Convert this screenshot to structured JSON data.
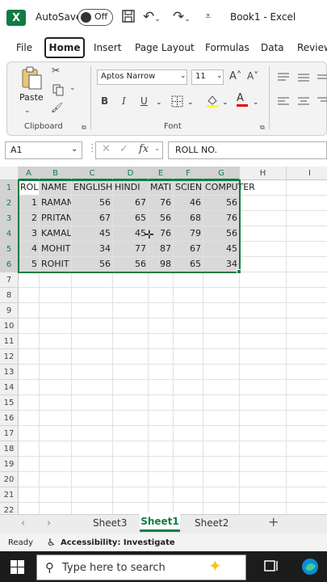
{
  "titlebar": {
    "autosave_label": "AutoSave",
    "toggle_state": "Off",
    "book_title": "Book1 - Excel"
  },
  "tabs": [
    "File",
    "Home",
    "Insert",
    "Page Layout",
    "Formulas",
    "Data",
    "Review"
  ],
  "ribbon": {
    "paste_label": "Paste",
    "clipboard_label": "Clipboard",
    "font_label": "Font",
    "font_name": "Aptos Narrow",
    "font_size": "11",
    "bold": "B",
    "italic": "I",
    "underline": "U",
    "grow_font": "A˄",
    "shrink_font": "A˅",
    "font_color_letter": "A"
  },
  "formula_bar": {
    "name_box": "A1",
    "fx": "fx",
    "value": "ROLL NO."
  },
  "columns": [
    "A",
    "B",
    "C",
    "D",
    "E",
    "F",
    "G",
    "H",
    "I"
  ],
  "rows": [
    "1",
    "2",
    "3",
    "4",
    "5",
    "6",
    "7",
    "8",
    "9",
    "10",
    "11",
    "12",
    "13",
    "14",
    "15",
    "16",
    "17",
    "18",
    "19",
    "20",
    "21",
    "22"
  ],
  "headers": [
    "ROL",
    "NAME",
    "ENGLISH",
    "HINDI",
    "MATI",
    "SCIEN",
    "COMPUTER"
  ],
  "data": [
    [
      "1",
      "RAMAN",
      "56",
      "67",
      "76",
      "46",
      "56"
    ],
    [
      "2",
      "PRITAN",
      "67",
      "65",
      "56",
      "68",
      "76"
    ],
    [
      "3",
      "KAMAL",
      "45",
      "45",
      "76",
      "79",
      "56"
    ],
    [
      "4",
      "MOHIT",
      "34",
      "77",
      "87",
      "67",
      "45"
    ],
    [
      "5",
      "ROHIT",
      "56",
      "56",
      "98",
      "65",
      "34"
    ]
  ],
  "sheets": [
    "Sheet3",
    "Sheet1",
    "Sheet2"
  ],
  "active_sheet": "Sheet1",
  "status": {
    "ready": "Ready",
    "accessibility": "Accessibility: Investigate"
  },
  "taskbar": {
    "search_placeholder": "Type here to search"
  },
  "colors": {
    "excel_green": "#107c41",
    "selection_fill": "#d9d9d9"
  }
}
